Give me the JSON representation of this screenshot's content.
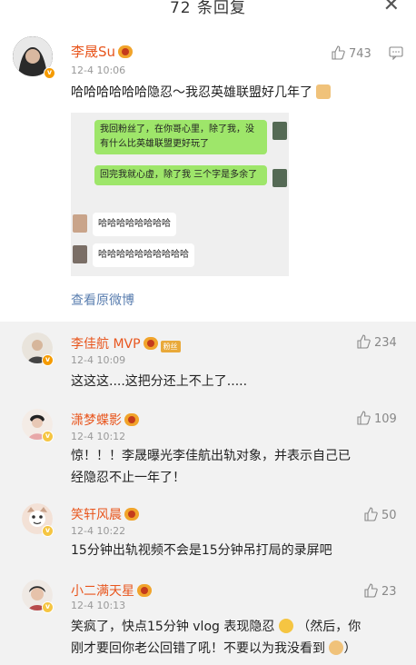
{
  "header": {
    "title": "72 条回复"
  },
  "main": {
    "name": "李晟Su",
    "time": "12-4 10:06",
    "likes": "743",
    "text": "哈哈哈哈哈哈隐忍～我忍英雄联盟好几年了",
    "chat": {
      "bubble1": "我回粉丝了，在你哥心里，除了我，没有什么比英雄联盟更好玩了",
      "bubble2": "回完我就心虚，除了我 三个字是多余了",
      "bubble3": "哈哈哈哈哈哈哈哈",
      "bubble4": "哈哈哈哈哈哈哈哈哈哈"
    },
    "view_original": "查看原微博"
  },
  "replies": [
    {
      "name": "李佳航 MVP",
      "time": "12-4 10:09",
      "likes": "234",
      "text": "这这这....这把分还上不上了....."
    },
    {
      "name": "潇梦蝶影",
      "time": "12-4 10:12",
      "likes": "109",
      "text_line1": "惊！！！李晟曝光李佳航出轨对象，并表示自己已",
      "text_line2": "经隐忍不止一年了！"
    },
    {
      "name": "笑轩风晨",
      "time": "12-4 10:22",
      "likes": "50",
      "text": "15分钟出轨视频不会是15分钟吊打局的录屏吧"
    },
    {
      "name": "小二满天星",
      "time": "12-4 10:13",
      "likes": "23",
      "text_line1": "笑疯了，快点15分钟 vlog 表现隐忍",
      "text_line1b": "（然后，你",
      "text_line2": "刚才要回你老公回错了吼！不要以为我没看到"
    }
  ],
  "colors": {
    "name": "#e8561e",
    "link": "#5b7fb0",
    "bubble": "#9ee66a",
    "reply_bg": "#f2f2f2"
  },
  "icons": [
    "close-icon",
    "thumbs-up-icon",
    "reply-icon",
    "verified-badge-icon",
    "vip-icon",
    "emoji-icon"
  ]
}
